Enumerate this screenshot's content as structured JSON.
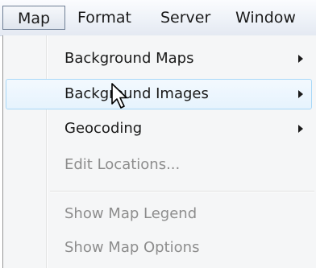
{
  "menubar": {
    "items": [
      {
        "label": "Map",
        "active": true
      },
      {
        "label": "Format"
      },
      {
        "label": "Server"
      },
      {
        "label": "Window"
      }
    ]
  },
  "dropdown": {
    "items": [
      {
        "label": "Background Maps",
        "submenu": true,
        "enabled": true
      },
      {
        "label": "Background Images",
        "submenu": true,
        "enabled": true,
        "highlighted": true
      },
      {
        "label": "Geocoding",
        "submenu": true,
        "enabled": true
      },
      {
        "label": "Edit Locations...",
        "submenu": false,
        "enabled": false
      },
      {
        "label": "Show Map Legend",
        "submenu": false,
        "enabled": false
      },
      {
        "label": "Show Map Options",
        "submenu": false,
        "enabled": false
      }
    ]
  },
  "colors": {
    "highlight_border": "#a8d8f8",
    "highlight_fill": "#e6f3fd",
    "disabled_text": "#8d8d8d",
    "menu_background": "#f5f6f7"
  },
  "cursor": {
    "icon": "arrow-pointer-icon"
  }
}
